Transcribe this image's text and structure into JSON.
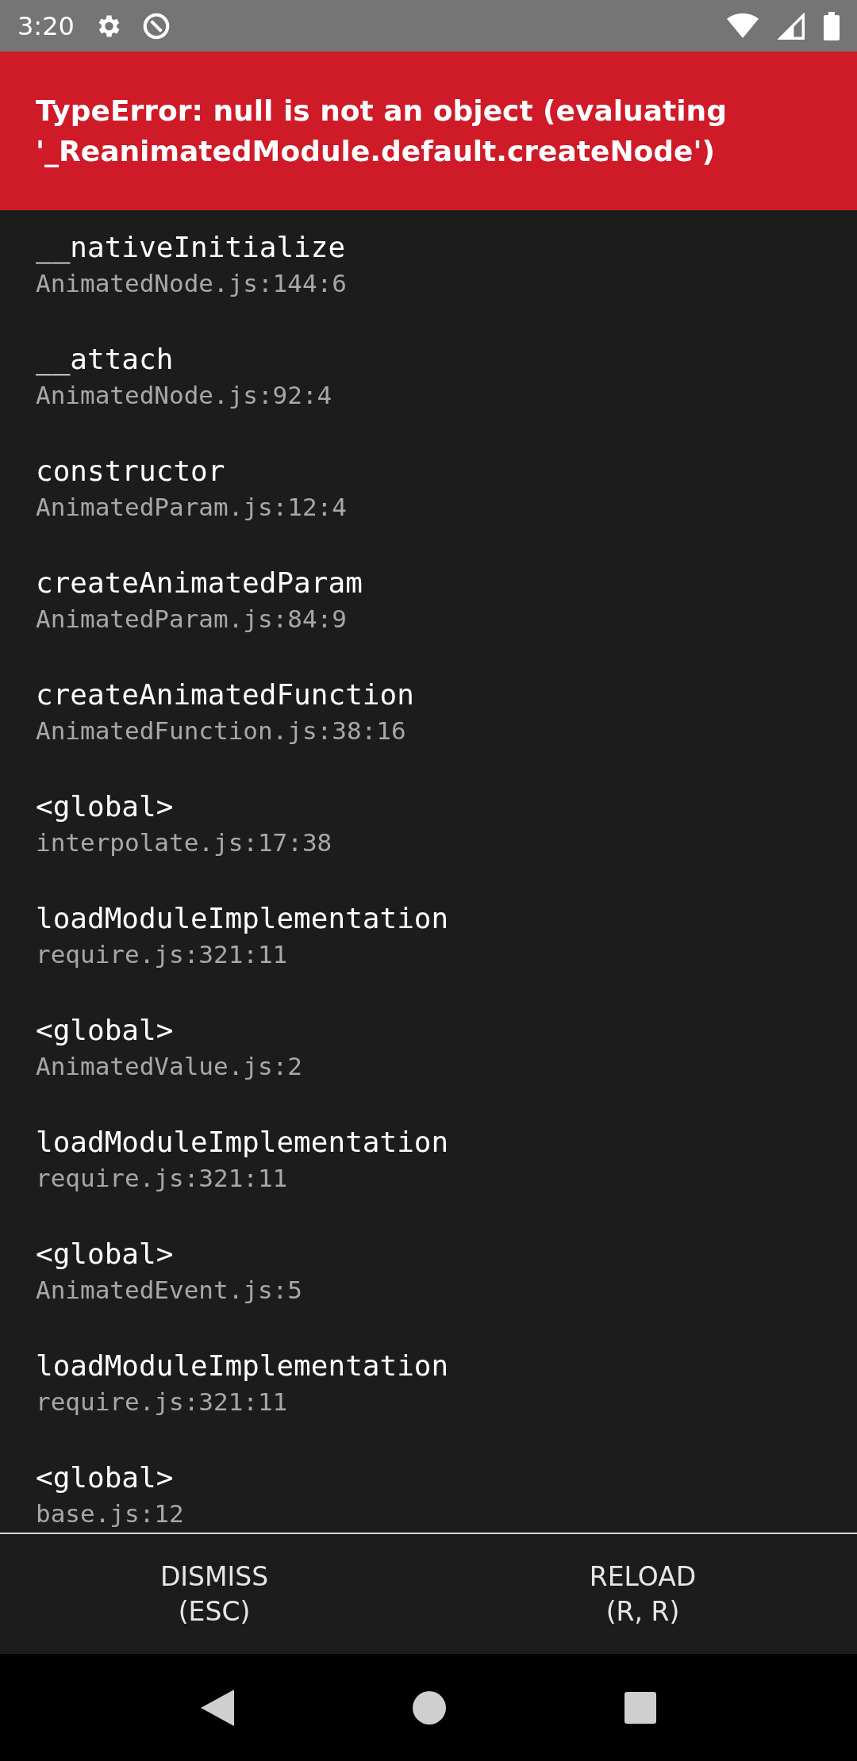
{
  "status_bar": {
    "time": "3:20"
  },
  "error": {
    "message": "TypeError: null is not an object (evaluating '_ReanimatedModule.default.createNode')"
  },
  "stack": [
    {
      "method": "__nativeInitialize",
      "file": "AnimatedNode.js:144:6"
    },
    {
      "method": "__attach",
      "file": "AnimatedNode.js:92:4"
    },
    {
      "method": "constructor",
      "file": "AnimatedParam.js:12:4"
    },
    {
      "method": "createAnimatedParam",
      "file": "AnimatedParam.js:84:9"
    },
    {
      "method": "createAnimatedFunction",
      "file": "AnimatedFunction.js:38:16"
    },
    {
      "method": "<global>",
      "file": "interpolate.js:17:38"
    },
    {
      "method": "loadModuleImplementation",
      "file": "require.js:321:11"
    },
    {
      "method": "<global>",
      "file": "AnimatedValue.js:2"
    },
    {
      "method": "loadModuleImplementation",
      "file": "require.js:321:11"
    },
    {
      "method": "<global>",
      "file": "AnimatedEvent.js:5"
    },
    {
      "method": "loadModuleImplementation",
      "file": "require.js:321:11"
    },
    {
      "method": "<global>",
      "file": "base.js:12"
    }
  ],
  "buttons": [
    {
      "label": "DISMISS",
      "shortcut": "(ESC)"
    },
    {
      "label": "RELOAD",
      "shortcut": "(R, R)"
    }
  ]
}
